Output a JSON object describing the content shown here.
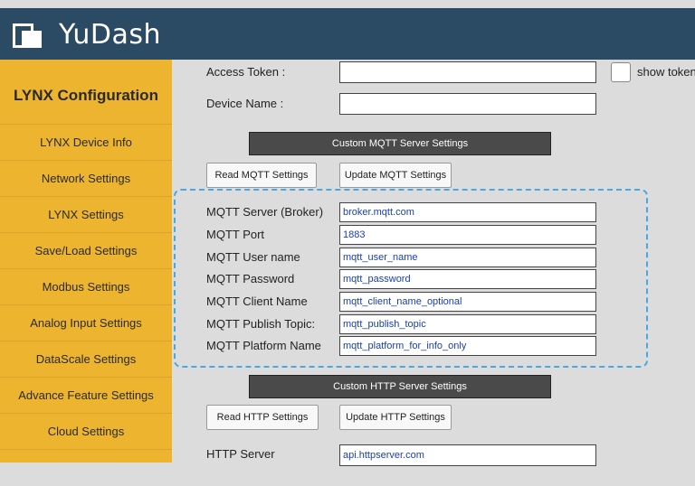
{
  "header": {
    "brand": "YuDash",
    "logo_icon": "yudash-logo-icon"
  },
  "sidebar": {
    "title": "LYNX Configuration",
    "items": [
      {
        "label": "LYNX Device Info"
      },
      {
        "label": "Network Settings"
      },
      {
        "label": "LYNX Settings"
      },
      {
        "label": "Save/Load Settings"
      },
      {
        "label": "Modbus Settings"
      },
      {
        "label": "Analog Input Settings"
      },
      {
        "label": "DataScale Settings"
      },
      {
        "label": "Advance Feature Settings"
      },
      {
        "label": "Cloud Settings"
      }
    ]
  },
  "top": {
    "access_token_label": "Access Token :",
    "access_token_value": "",
    "show_token_label": "show token",
    "device_name_label": "Device Name :",
    "device_name_value": ""
  },
  "mqtt": {
    "header": "Custom MQTT Server Settings",
    "read_button": "Read MQTT Settings",
    "update_button": "Update MQTT Settings",
    "fields": [
      {
        "label": "MQTT Server (Broker)",
        "value": "broker.mqtt.com"
      },
      {
        "label": "MQTT Port",
        "value": "1883"
      },
      {
        "label": "MQTT User name",
        "value": "mqtt_user_name"
      },
      {
        "label": "MQTT Password",
        "value": "mqtt_password"
      },
      {
        "label": "MQTT Client Name",
        "value": "mqtt_client_name_optional"
      },
      {
        "label": "MQTT Publish Topic:",
        "value": "mqtt_publish_topic"
      },
      {
        "label": "MQTT Platform Name",
        "value": "mqtt_platform_for_info_only"
      }
    ]
  },
  "http": {
    "header": "Custom HTTP Server Settings",
    "read_button": "Read HTTP Settings",
    "update_button": "Update HTTP Settings",
    "server_label": "HTTP Server",
    "server_value": "api.httpserver.com"
  },
  "colors": {
    "header_bg": "#2b4a64",
    "sidebar_bg": "#ecb42f",
    "content_bg": "#dcdcdc",
    "section_header_bg": "#4a4a4a",
    "highlight_border": "#4aa8e0",
    "input_text": "#1a3fa8"
  }
}
